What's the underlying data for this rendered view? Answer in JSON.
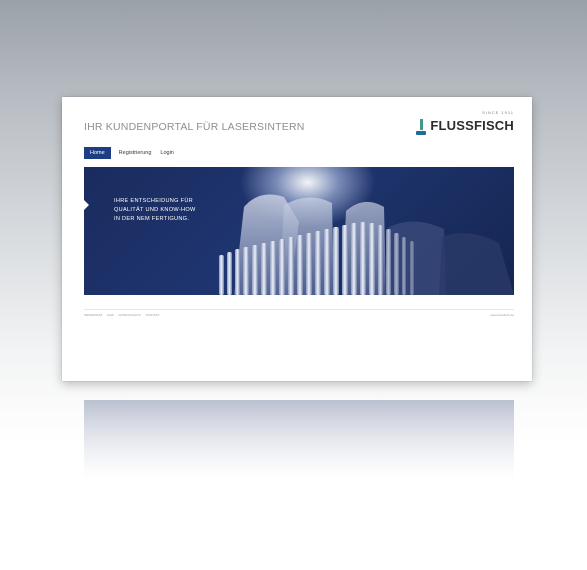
{
  "header": {
    "portal_title": "IHR KUNDENPORTAL FÜR LASERSINTERN",
    "logo_text": "FLUSSFISCH",
    "logo_since": "SINCE 1911"
  },
  "nav": {
    "items": [
      {
        "label": "Home",
        "active": true
      },
      {
        "label": "Registrierung",
        "active": false
      },
      {
        "label": "Login",
        "active": false
      }
    ]
  },
  "hero": {
    "lines": [
      "IHRE ENTSCHEIDUNG FÜR",
      "QUALITÄT UND KNOW-HOW",
      "IN DER NEM FERTIGUNG."
    ]
  },
  "footer": {
    "links": [
      "IMPRESSUM",
      "AGB",
      "DATENSCHUTZ",
      "KONTAKT"
    ],
    "right_text": "www.flussfisch.de"
  },
  "colors": {
    "nav_active": "#1d3e85",
    "hero_dark": "#1a2c5e",
    "logo_green": "#3f9a8d",
    "logo_blue": "#1f6f94"
  }
}
